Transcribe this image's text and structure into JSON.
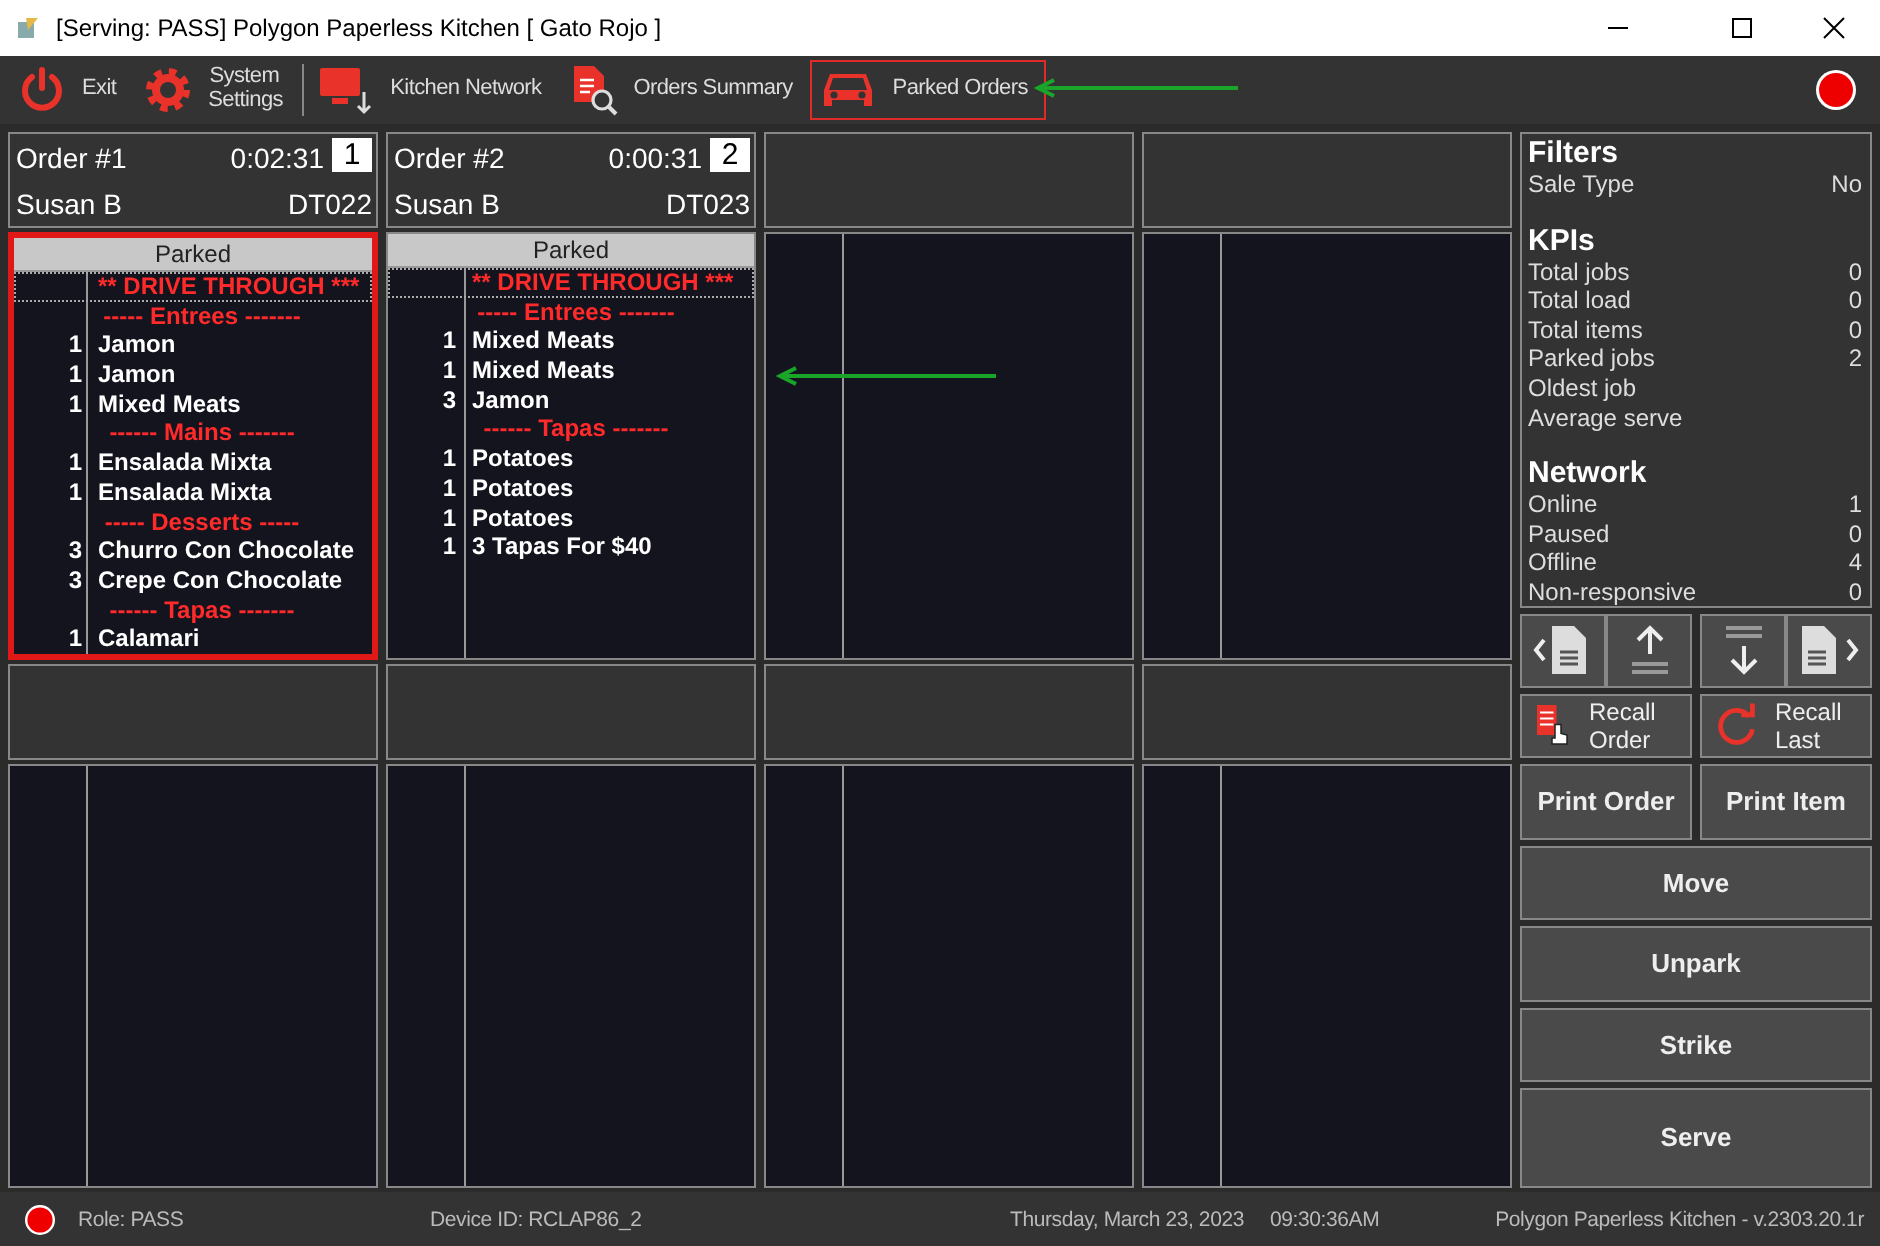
{
  "window": {
    "title": "[Serving: PASS] Polygon Paperless Kitchen [ Gato Rojo ]"
  },
  "toolbar": [
    {
      "label": "Exit",
      "selected": false
    },
    {
      "label": "System Settings",
      "selected": false
    },
    {
      "label": "Kitchen Network",
      "selected": false
    },
    {
      "label": "Orders Summary",
      "selected": false
    },
    {
      "label": "Parked Orders",
      "selected": true
    }
  ],
  "slots": [
    {
      "kind": "order",
      "title": "Order #1",
      "timer": "0:02:31",
      "number": "1",
      "server": "Susan B",
      "table": "DT022",
      "state": "Parked",
      "selected": true,
      "lines": [
        {
          "kind": "banner",
          "text": "** DRIVE THROUGH ***"
        },
        {
          "kind": "course",
          "text": "----- Entrees -------"
        },
        {
          "kind": "item",
          "qty": "1",
          "text": "Jamon"
        },
        {
          "kind": "item",
          "qty": "1",
          "text": "Jamon"
        },
        {
          "kind": "item",
          "qty": "1",
          "text": "Mixed Meats"
        },
        {
          "kind": "course",
          "text": "------ Mains -------"
        },
        {
          "kind": "item",
          "qty": "1",
          "text": "Ensalada Mixta"
        },
        {
          "kind": "item",
          "qty": "1",
          "text": "Ensalada Mixta"
        },
        {
          "kind": "course",
          "text": "----- Desserts -----"
        },
        {
          "kind": "item",
          "qty": "3",
          "text": "Churro Con Chocolate"
        },
        {
          "kind": "item",
          "qty": "3",
          "text": "Crepe Con Chocolate"
        },
        {
          "kind": "course",
          "text": "------ Tapas -------"
        },
        {
          "kind": "item",
          "qty": "1",
          "text": "Calamari"
        }
      ]
    },
    {
      "kind": "order",
      "title": "Order #2",
      "timer": "0:00:31",
      "number": "2",
      "server": "Susan B",
      "table": "DT023",
      "state": "Parked",
      "selected": false,
      "lines": [
        {
          "kind": "banner",
          "text": "** DRIVE THROUGH ***"
        },
        {
          "kind": "course",
          "text": "----- Entrees -------"
        },
        {
          "kind": "item",
          "qty": "1",
          "text": "Mixed Meats"
        },
        {
          "kind": "item",
          "qty": "1",
          "text": "Mixed Meats"
        },
        {
          "kind": "item",
          "qty": "3",
          "text": "Jamon"
        },
        {
          "kind": "course",
          "text": "------ Tapas -------"
        },
        {
          "kind": "item",
          "qty": "1",
          "text": "Potatoes"
        },
        {
          "kind": "item",
          "qty": "1",
          "text": "Potatoes"
        },
        {
          "kind": "item",
          "qty": "1",
          "text": "Potatoes"
        },
        {
          "kind": "item",
          "qty": "1",
          "text": "3 Tapas For $40"
        }
      ]
    },
    {
      "kind": "empty"
    },
    {
      "kind": "empty"
    },
    {
      "kind": "empty"
    },
    {
      "kind": "empty"
    },
    {
      "kind": "empty"
    },
    {
      "kind": "empty"
    }
  ],
  "sidebar": {
    "sections": [
      {
        "title": "Filters",
        "rows": [
          {
            "label": "Sale Type",
            "value": "No"
          }
        ]
      },
      {
        "title": "KPIs",
        "rows": [
          {
            "label": "Total jobs",
            "value": "0"
          },
          {
            "label": "Total load",
            "value": "0"
          },
          {
            "label": "Total items",
            "value": "0"
          },
          {
            "label": "Parked jobs",
            "value": "2"
          },
          {
            "label": "Oldest job"
          },
          {
            "label": "Average serve"
          }
        ]
      },
      {
        "title": "Network",
        "rows": [
          {
            "label": "Online",
            "value": "1"
          },
          {
            "label": "Paused",
            "value": "0"
          },
          {
            "label": "Offline",
            "value": "4"
          },
          {
            "label": "Non-responsive",
            "value": "0"
          }
        ]
      }
    ],
    "buttons": [
      {
        "label": "Recall Order"
      },
      {
        "label": "Recall Last"
      },
      {
        "label": "Print Order"
      },
      {
        "label": "Print Item"
      },
      {
        "label": "Move"
      },
      {
        "label": "Unpark"
      },
      {
        "label": "Strike"
      },
      {
        "label": "Serve"
      }
    ]
  },
  "status_bar": {
    "role": "Role: PASS",
    "device": "Device ID: RCLAP86_2",
    "date": "Thursday, March 23, 2023",
    "time": "09:30:36AM",
    "version": "Polygon Paperless Kitchen - v.2303.20.1r"
  }
}
